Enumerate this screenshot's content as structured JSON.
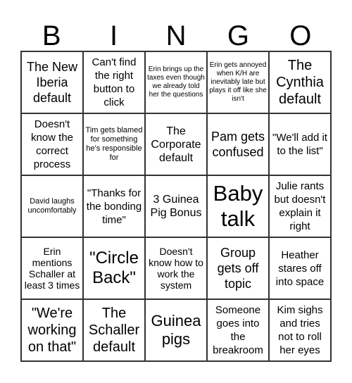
{
  "header": [
    "B",
    "I",
    "N",
    "G",
    "O"
  ],
  "cells": [
    "The New Iberia default",
    "Can't find the right button to click",
    "Erin brings up the taxes even though we already told her the questions",
    "Erin gets annoyed when K/H are inevitably late but plays it off like she isn't",
    "The Cynthia default",
    "Doesn't know the correct process",
    "Tim gets blamed for something he's responsible for",
    "The Corporate default",
    "Pam gets confused",
    "\"We'll add it to the list\"",
    "David laughs uncomfortably",
    "\"Thanks for the bonding time\"",
    "3 Guinea Pig Bonus",
    "Baby talk",
    "Julie rants but doesn't explain it right",
    "Erin mentions Schaller at least 3 times",
    "\"Circle Back\"",
    "Doesn't know how to work the system",
    "Group gets off topic",
    "Heather stares off into space",
    "\"We're working on that\"",
    "The Schaller default",
    "Guinea pigs",
    "Someone goes into the breakroom",
    "Kim sighs and tries not to roll her eyes"
  ]
}
